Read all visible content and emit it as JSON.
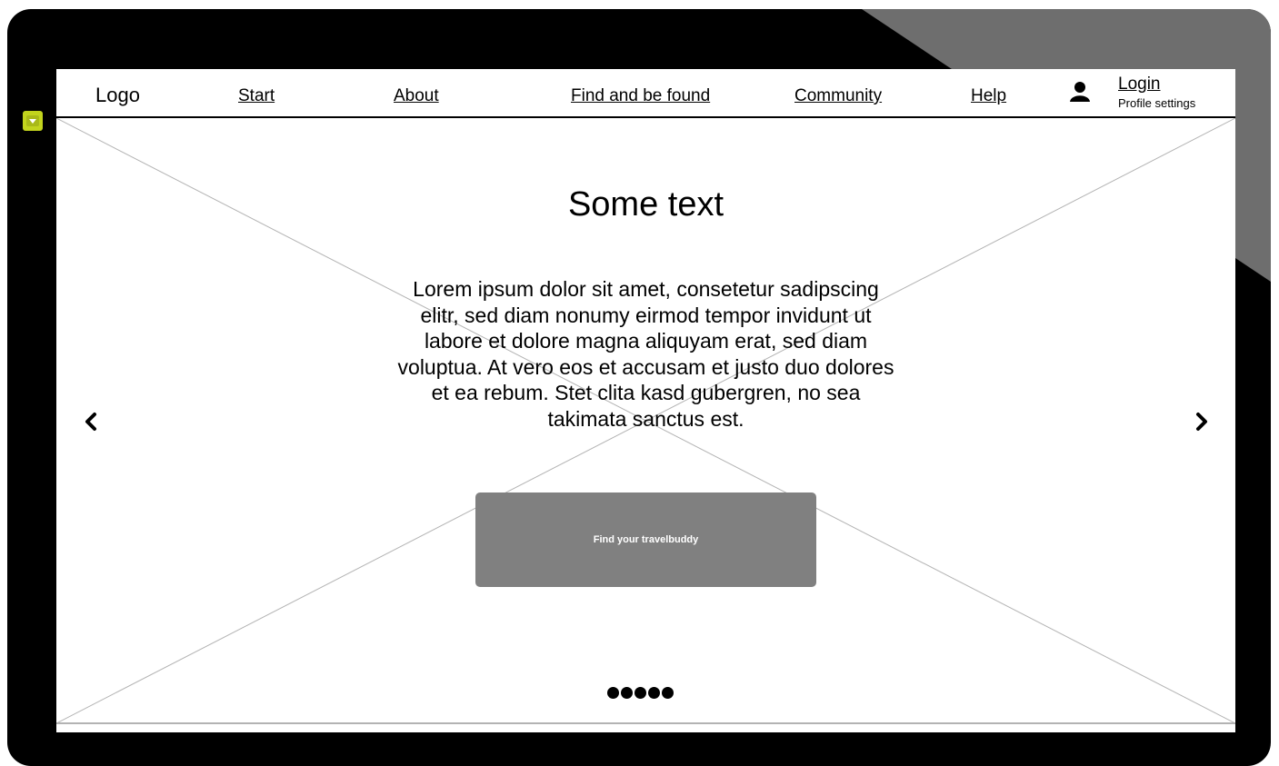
{
  "nav": {
    "logo": "Logo",
    "links": [
      "Start",
      "About",
      "Find and be found",
      "Community",
      "Help"
    ],
    "login": "Login",
    "profile_settings": "Profile settings"
  },
  "hero": {
    "title": "Some text",
    "body": "Lorem ipsum dolor sit amet, consetetur sadipscing elitr, sed diam nonumy eirmod tempor invidunt ut labore et dolore magna aliquyam erat, sed diam voluptua. At vero eos et accusam et justo duo dolores et ea rebum. Stet clita kasd gubergren, no sea takimata sanctus est.",
    "cta_label": "Find your travelbuddy"
  },
  "carousel": {
    "dot_count": 5
  },
  "icons": {
    "user": "user-icon",
    "prev": "chevron-left-icon",
    "next": "chevron-right-icon",
    "badge": "triangle-down-icon"
  },
  "colors": {
    "frame": "#000000",
    "cta_bg": "#808080",
    "badge": "#c2d41d",
    "glare": "#6e6e6e"
  }
}
